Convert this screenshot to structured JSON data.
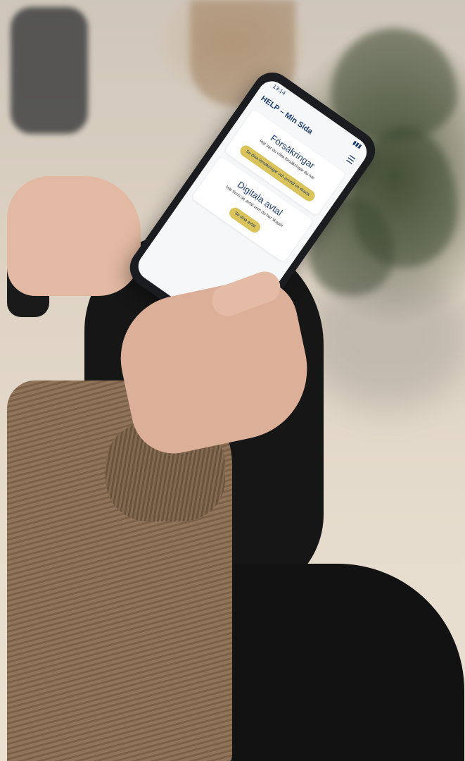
{
  "phone": {
    "status_time": "13:14",
    "app_title": "HELP – Min Sida",
    "cards": [
      {
        "title": "Försäkringar",
        "text": "Här ser du vilka försäkringar du har",
        "button": "Se dina försäkringar och anmäl en skada"
      },
      {
        "title": "Digitala avtal",
        "text": "Här finns de avtal som du har skapat",
        "button": "Se dina avtal"
      }
    ]
  },
  "colors": {
    "accent": "#d9c35a",
    "brand": "#1b3a6b"
  }
}
